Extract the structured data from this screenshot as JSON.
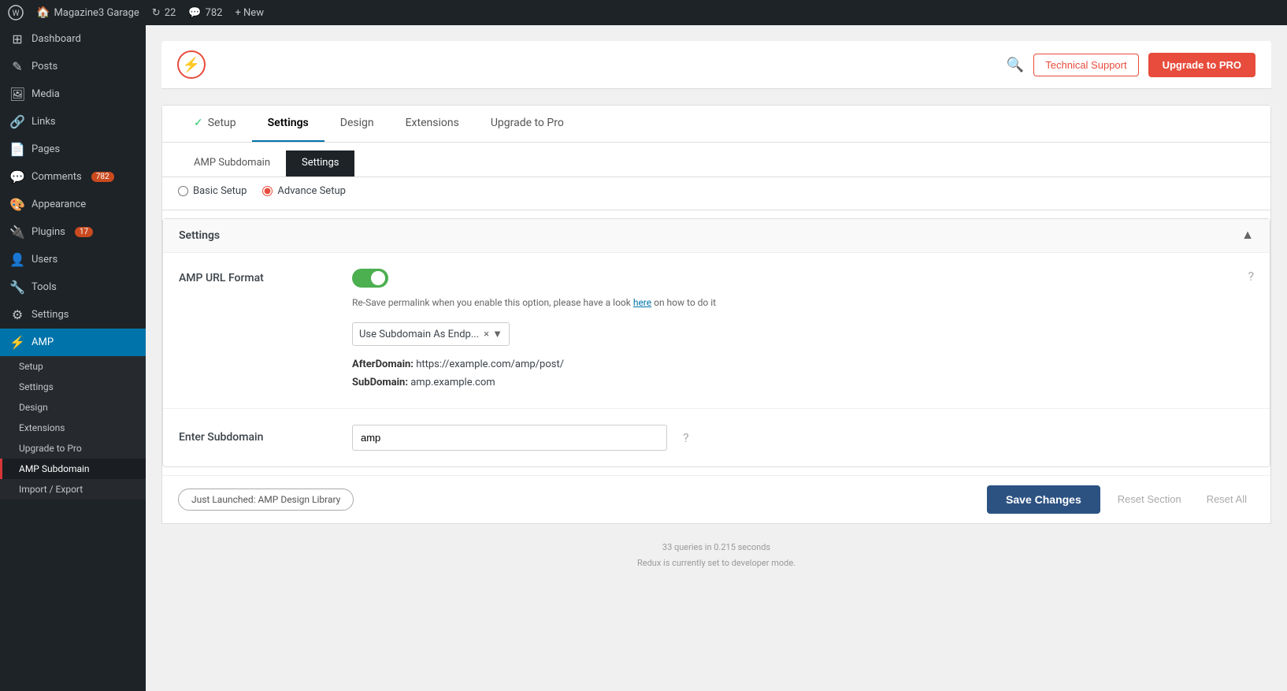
{
  "adminBar": {
    "wpLogoIcon": "⊞",
    "siteName": "Magazine3 Garage",
    "updatesIcon": "↻",
    "updatesCount": "22",
    "commentsIcon": "💬",
    "commentsCount": "782",
    "newLabel": "+ New"
  },
  "sidebar": {
    "items": [
      {
        "id": "dashboard",
        "icon": "⊞",
        "label": "Dashboard"
      },
      {
        "id": "posts",
        "icon": "✎",
        "label": "Posts"
      },
      {
        "id": "media",
        "icon": "🖼",
        "label": "Media"
      },
      {
        "id": "links",
        "icon": "🔗",
        "label": "Links"
      },
      {
        "id": "pages",
        "icon": "📄",
        "label": "Pages"
      },
      {
        "id": "comments",
        "icon": "💬",
        "label": "Comments",
        "badge": "782"
      },
      {
        "id": "appearance",
        "icon": "🎨",
        "label": "Appearance"
      },
      {
        "id": "plugins",
        "icon": "🔌",
        "label": "Plugins",
        "badge": "17"
      },
      {
        "id": "users",
        "icon": "👤",
        "label": "Users"
      },
      {
        "id": "tools",
        "icon": "🔧",
        "label": "Tools"
      },
      {
        "id": "settings",
        "icon": "⚙",
        "label": "Settings"
      }
    ],
    "amp": {
      "mainLabel": "AMP",
      "icon": "⚡",
      "subItems": [
        {
          "id": "setup",
          "label": "Setup"
        },
        {
          "id": "settings",
          "label": "Settings"
        },
        {
          "id": "design",
          "label": "Design"
        },
        {
          "id": "extensions",
          "label": "Extensions"
        },
        {
          "id": "upgrade-pro",
          "label": "Upgrade to Pro"
        },
        {
          "id": "amp-subdomain",
          "label": "AMP Subdomain",
          "highlighted": true
        },
        {
          "id": "import-export",
          "label": "Import / Export"
        }
      ]
    }
  },
  "header": {
    "logoIcon": "⚡",
    "searchIcon": "🔍",
    "techSupportLabel": "Technical Support",
    "upgradeLabel": "Upgrade to PRO"
  },
  "tabs": [
    {
      "id": "setup",
      "label": "Setup",
      "hasCheck": true
    },
    {
      "id": "settings",
      "label": "Settings",
      "active": true
    },
    {
      "id": "design",
      "label": "Design"
    },
    {
      "id": "extensions",
      "label": "Extensions"
    },
    {
      "id": "upgrade-pro",
      "label": "Upgrade to Pro"
    }
  ],
  "subTabs": [
    {
      "id": "amp-subdomain",
      "label": "AMP Subdomain"
    },
    {
      "id": "settings",
      "label": "Settings",
      "active": true
    }
  ],
  "radioOptions": [
    {
      "id": "basic-setup",
      "label": "Basic Setup",
      "checked": false
    },
    {
      "id": "advance-setup",
      "label": "Advance Setup",
      "checked": true
    }
  ],
  "settingsPanel": {
    "title": "Settings",
    "collapseIcon": "▲",
    "fields": [
      {
        "id": "amp-url-format",
        "label": "AMP URL Format",
        "toggleEnabled": true,
        "helpText": "Re-Save permalink when you enable this option, please have a look",
        "helpLink": "here",
        "helpTextSuffix": "on how to do it",
        "selectValue": "Use Subdomain As Endp...",
        "afterDomain": "https://example.com/amp/post/",
        "subDomain": "amp.example.com"
      }
    ],
    "subdomainField": {
      "label": "Enter Subdomain",
      "value": "amp",
      "placeholder": "amp"
    }
  },
  "footer": {
    "launchedBadge": "Just Launched: AMP Design Library",
    "saveLabel": "Save Changes",
    "resetSectionLabel": "Reset Section",
    "resetAllLabel": "Reset All"
  },
  "footerInfo": {
    "line1": "33 queries in 0.215 seconds",
    "line2": "Redux is currently set to developer mode."
  },
  "colors": {
    "accent": "#e74c3c",
    "blue": "#0073aa",
    "darkBlue": "#2c5282",
    "green": "#4caf50",
    "adminBarBg": "#1d2327",
    "sidebarBg": "#1d2327"
  }
}
